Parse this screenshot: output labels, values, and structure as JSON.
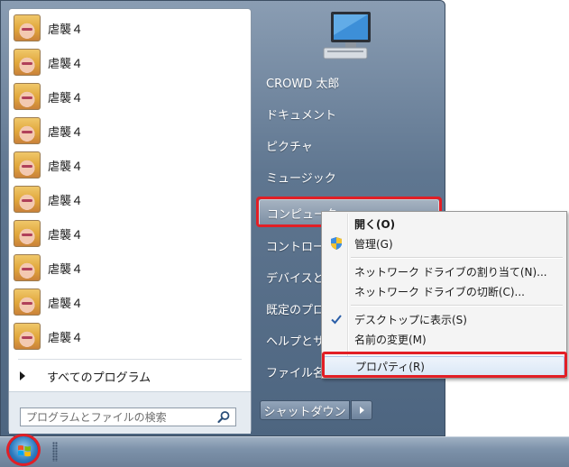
{
  "programs": [
    {
      "label": "虐襲４"
    },
    {
      "label": "虐襲４"
    },
    {
      "label": "虐襲４"
    },
    {
      "label": "虐襲４"
    },
    {
      "label": "虐襲４"
    },
    {
      "label": "虐襲４"
    },
    {
      "label": "虐襲４"
    },
    {
      "label": "虐襲４"
    },
    {
      "label": "虐襲４"
    },
    {
      "label": "虐襲４"
    }
  ],
  "all_programs": {
    "label": "すべてのプログラム"
  },
  "search": {
    "placeholder": "プログラムとファイルの検索"
  },
  "right_pane": {
    "items": [
      {
        "label": "CROWD 太郎"
      },
      {
        "label": "ドキュメント"
      },
      {
        "label": "ピクチャ"
      },
      {
        "label": "ミュージック"
      },
      {
        "label": "コンピューター"
      },
      {
        "label": "コントロー"
      },
      {
        "label": "デバイスと"
      },
      {
        "label": "既定のプロ"
      },
      {
        "label": "ヘルプとサ"
      },
      {
        "label": "ファイル名"
      }
    ]
  },
  "shutdown": {
    "label": "シャットダウン"
  },
  "context_menu": {
    "items": [
      {
        "label": "開く(O)"
      },
      {
        "label": "管理(G)"
      },
      {
        "label": "ネットワーク ドライブの割り当て(N)..."
      },
      {
        "label": "ネットワーク ドライブの切断(C)..."
      },
      {
        "label": "デスクトップに表示(S)"
      },
      {
        "label": "名前の変更(M)"
      },
      {
        "label": "プロパティ(R)"
      }
    ]
  },
  "colors": {
    "highlight": "#e21f26",
    "start_menu_bg": "#5f7690",
    "taskbar_bg": "#7d92aa"
  }
}
